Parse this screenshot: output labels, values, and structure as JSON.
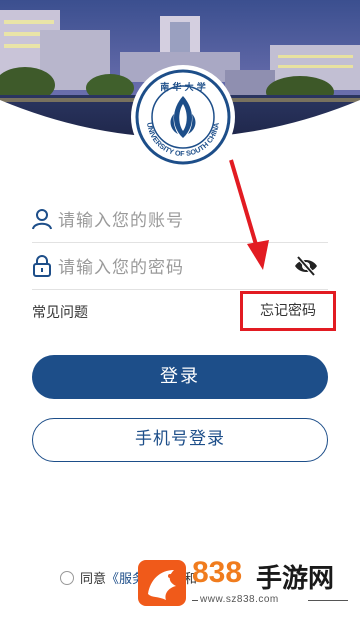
{
  "login": {
    "account_placeholder": "请输入您的账号",
    "password_placeholder": "请输入您的密码",
    "faq_label": "常见问题",
    "forgot_label": "忘记密码",
    "login_button": "登录",
    "phone_login_button": "手机号登录"
  },
  "agreement": {
    "prefix": "同意",
    "link_text": "《服务协议》",
    "suffix": "和"
  },
  "logo": {
    "text": "UNIVERSITY OF SOUTH CHINA"
  },
  "watermark": {
    "number": "838",
    "brand": "手游网",
    "url": "www.sz838.com"
  },
  "colors": {
    "primary": "#1d4e89",
    "highlight": "#e21b22",
    "watermark_orange": "#f07c1e"
  }
}
